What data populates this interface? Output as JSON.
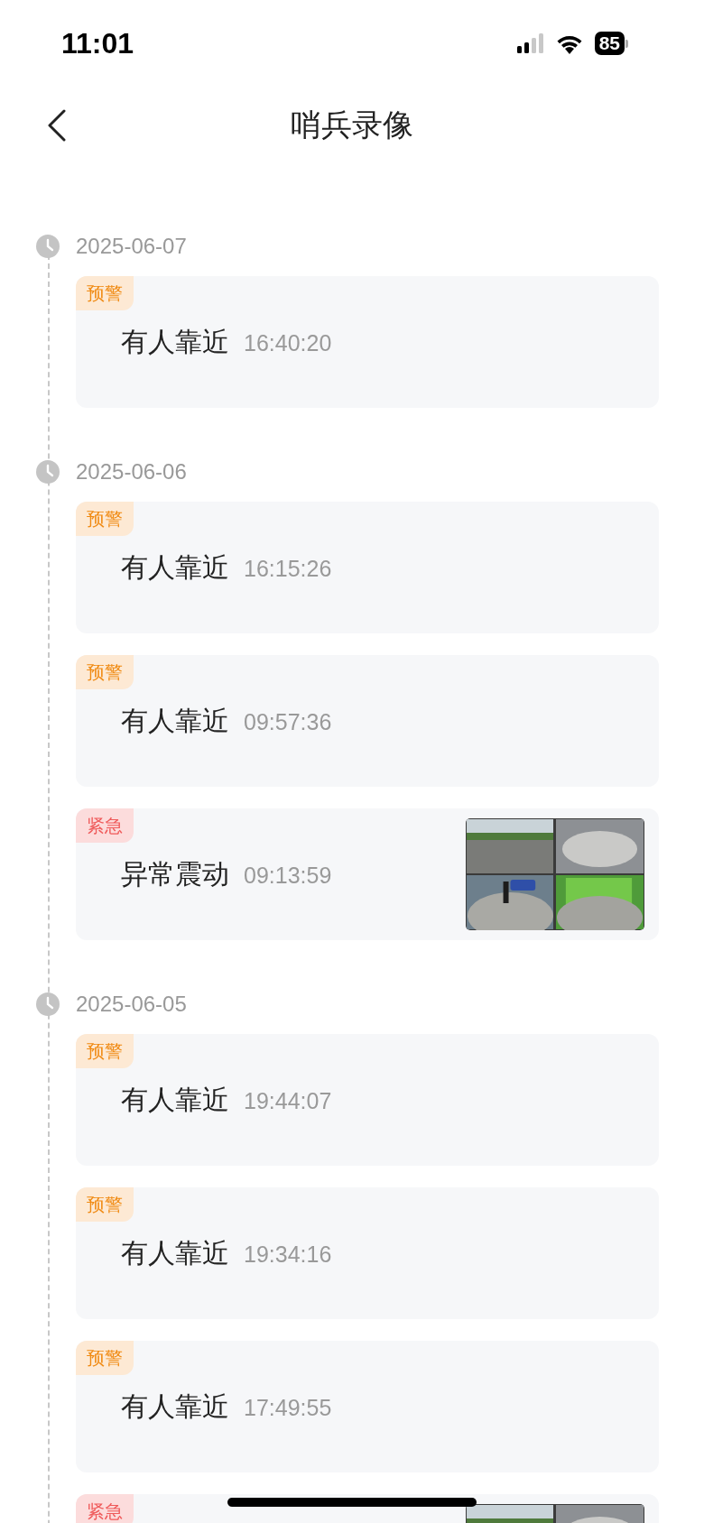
{
  "status_bar": {
    "time": "11:01",
    "battery": "85"
  },
  "nav": {
    "title": "哨兵录像"
  },
  "timeline": [
    {
      "date": "2025-06-07",
      "events": [
        {
          "tag": {
            "kind": "warning",
            "label": "预警"
          },
          "title": "有人靠近",
          "time": "16:40:20"
        }
      ]
    },
    {
      "date": "2025-06-06",
      "events": [
        {
          "tag": {
            "kind": "warning",
            "label": "预警"
          },
          "title": "有人靠近",
          "time": "16:15:26"
        },
        {
          "tag": {
            "kind": "warning",
            "label": "预警"
          },
          "title": "有人靠近",
          "time": "09:57:36"
        },
        {
          "tag": {
            "kind": "urgent",
            "label": "紧急"
          },
          "title": "异常震动",
          "time": "09:13:59"
        }
      ]
    },
    {
      "date": "2025-06-05",
      "events": [
        {
          "tag": {
            "kind": "warning",
            "label": "预警"
          },
          "title": "有人靠近",
          "time": "19:44:07"
        },
        {
          "tag": {
            "kind": "warning",
            "label": "预警"
          },
          "title": "有人靠近",
          "time": "19:34:16"
        },
        {
          "tag": {
            "kind": "warning",
            "label": "预警"
          },
          "title": "有人靠近",
          "time": "17:49:55"
        },
        {
          "tag": {
            "kind": "urgent",
            "label": "紧急"
          }
        }
      ]
    }
  ]
}
